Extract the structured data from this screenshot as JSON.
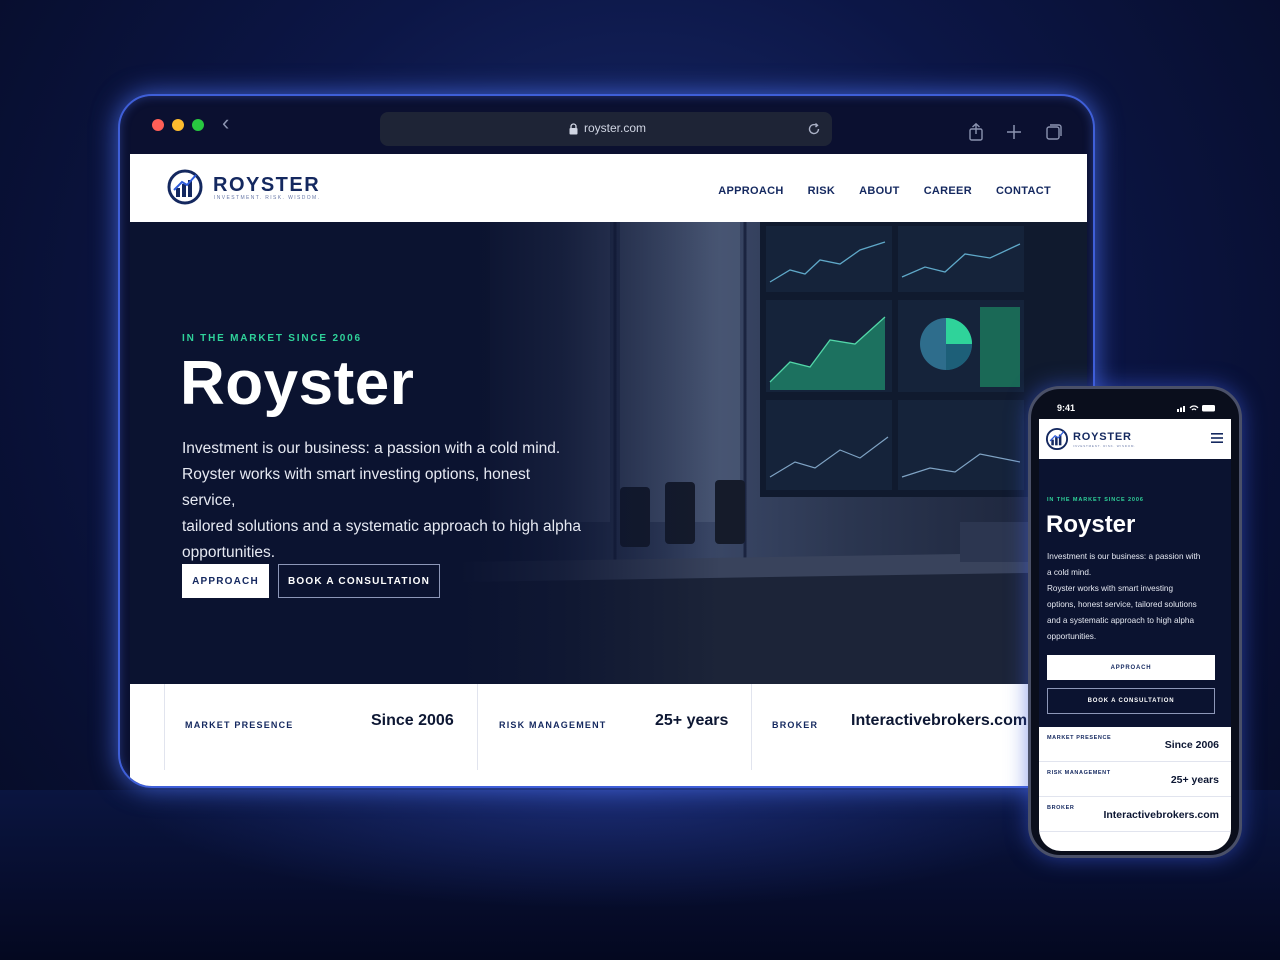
{
  "browser": {
    "url": "royster.com"
  },
  "site": {
    "brand": {
      "name": "ROYSTER",
      "tagline": "INVESTMENT. RISK. WISDOM."
    },
    "nav": [
      "APPROACH",
      "RISK",
      "ABOUT",
      "CAREER",
      "CONTACT"
    ],
    "hero": {
      "eyebrow": "IN THE MARKET SINCE 2006",
      "title": "Royster",
      "lines": [
        "Investment is our business: a passion with a cold mind.",
        "Royster works with smart investing options, honest service,",
        "tailored solutions and a systematic approach to high alpha",
        "opportunities."
      ],
      "primary_button": "APPROACH",
      "secondary_button": "BOOK A CONSULTATION"
    },
    "stats": [
      {
        "label": "MARKET PRESENCE",
        "value": "Since 2006"
      },
      {
        "label": "RISK MANAGEMENT",
        "value": "25+ years"
      },
      {
        "label": "BROKER",
        "value": "Interactivebrokers.com"
      }
    ]
  },
  "phone": {
    "time": "9:41",
    "hero_lines": [
      "Investment is our business: a passion with",
      "a cold mind.",
      "Royster works with smart investing",
      "options, honest service, tailored solutions",
      "and a systematic approach to high alpha",
      "opportunities."
    ]
  },
  "colors": {
    "navy": "#14285f",
    "accent_green": "#2fd39a",
    "frame_glow": "#3f5fd8"
  }
}
